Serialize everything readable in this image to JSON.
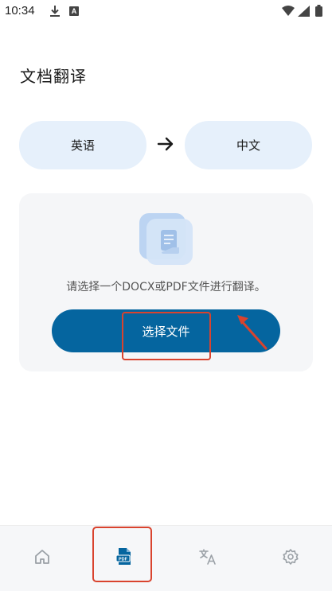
{
  "status_bar": {
    "time": "10:34",
    "icons": [
      "download-icon",
      "a-notification-icon",
      "wifi-icon",
      "signal-icon",
      "battery-icon"
    ]
  },
  "page": {
    "title": "文档翻译"
  },
  "language": {
    "source": "英语",
    "target": "中文",
    "arrow_icon": "arrow-right-icon"
  },
  "upload": {
    "icon": "document-icon",
    "hint": "请选择一个DOCX或PDF文件进行翻译。",
    "button_label": "选择文件"
  },
  "bottom_nav": {
    "items": [
      {
        "icon": "home-icon",
        "active": false
      },
      {
        "icon": "pdf-document-icon",
        "active": true
      },
      {
        "icon": "translate-icon",
        "active": false
      },
      {
        "icon": "settings-gear-icon",
        "active": false
      }
    ]
  },
  "colors": {
    "accent": "#05659f",
    "pill_bg": "#e6f0fb",
    "card_bg": "#f5f6f8",
    "annotation_red": "#d9432e",
    "inactive_icon": "#9aa0a6"
  }
}
